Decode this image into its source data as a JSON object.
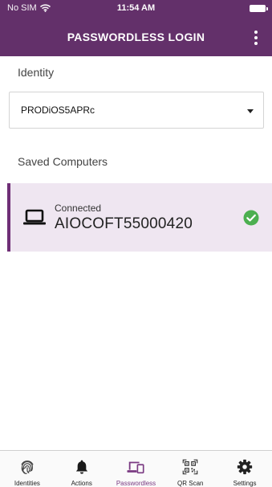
{
  "status_bar": {
    "carrier": "No SIM",
    "time": "11:54 AM"
  },
  "header": {
    "title": "PASSWORDLESS LOGIN",
    "menu_icon": "more-vertical-icon"
  },
  "identity": {
    "label": "Identity",
    "selected": "PRODiOS5APRc"
  },
  "saved_computers": {
    "label": "Saved Computers",
    "items": [
      {
        "status": "Connected",
        "name": "AIOCOFT55000420",
        "icon": "laptop-icon",
        "status_icon": "check-circle-icon"
      }
    ]
  },
  "bottom_nav": {
    "active": "Passwordless",
    "items": [
      {
        "label": "Identities",
        "icon": "fingerprint-icon"
      },
      {
        "label": "Actions",
        "icon": "bell-icon"
      },
      {
        "label": "Passwordless",
        "icon": "devices-icon"
      },
      {
        "label": "QR Scan",
        "icon": "qr-code-icon"
      },
      {
        "label": "Settings",
        "icon": "gear-icon"
      }
    ]
  },
  "colors": {
    "header": "#63306a",
    "accent": "#7a3a82",
    "selected_row": "#efe6f1",
    "success": "#4caf50"
  }
}
